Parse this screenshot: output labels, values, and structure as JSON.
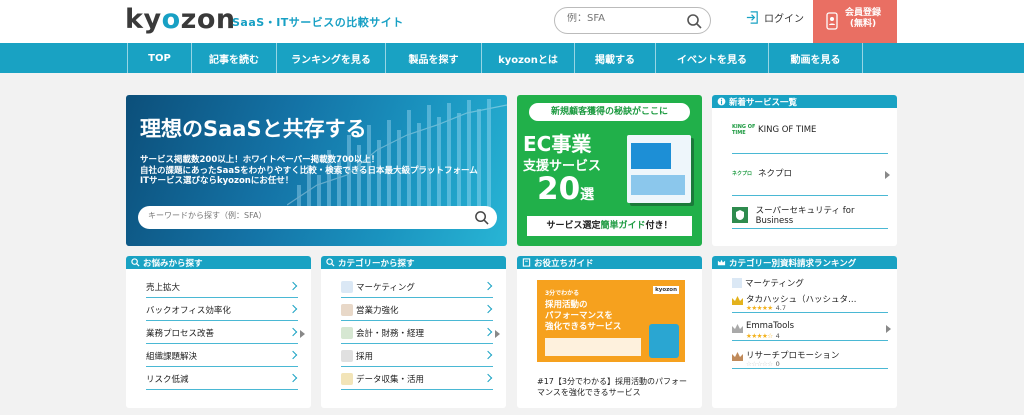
{
  "header": {
    "logo_text": "kyozon",
    "tagline": "SaaS・ITサービスの比較サイト",
    "search_placeholder": "例：SFA",
    "login_label": "ログイン",
    "register_label_line1": "会員登録",
    "register_label_line2": "(無料)"
  },
  "nav": {
    "items": [
      {
        "label": "TOP"
      },
      {
        "label": "記事を読む"
      },
      {
        "label": "ランキングを見る"
      },
      {
        "label": "製品を探す"
      },
      {
        "label": "kyozonとは"
      },
      {
        "label": "掲載する"
      },
      {
        "label": "イベントを見る"
      },
      {
        "label": "動画を見る"
      }
    ]
  },
  "hero": {
    "title": "理想のSaaSと共存する",
    "line1": "サービス掲載数200以上！ホワイトペーパー掲載数700以上！",
    "line2": "自社の課題にあったSaaSをわかりやすく比較・検索できる日本最大級プラットフォーム",
    "line3": "ITサービス選びならkyozonにお任せ！",
    "search_placeholder": "キーワードから探す（例：SFA）"
  },
  "ec_banner": {
    "pill": "新規顧客獲得の秘訣がここに",
    "big": "EC事業",
    "mid": "支援サービス",
    "num": "20",
    "num_suffix": "選",
    "bottom_prefix": "サービス選定",
    "bottom_highlight": "簡単ガイド",
    "bottom_suffix": "付き！"
  },
  "new_services": {
    "title": "新着サービス一覧",
    "items": [
      {
        "logo": "KING OF TIME",
        "name": "KING OF TIME"
      },
      {
        "logo": "ネクプロ",
        "name": "ネクプロ"
      },
      {
        "logo": "",
        "name": "スーパーセキュリティ for Business"
      }
    ]
  },
  "worries": {
    "title": "お悩みから探す",
    "items": [
      {
        "label": "売上拡大"
      },
      {
        "label": "バックオフィス効率化"
      },
      {
        "label": "業務プロセス改善"
      },
      {
        "label": "組織課題解決"
      },
      {
        "label": "リスク低減"
      }
    ]
  },
  "categories": {
    "title": "カテゴリーから探す",
    "items": [
      {
        "label": "マーケティング"
      },
      {
        "label": "営業力強化"
      },
      {
        "label": "会計・財務・経理"
      },
      {
        "label": "採用"
      },
      {
        "label": "データ収集・活用"
      }
    ]
  },
  "guide": {
    "title": "お役立ちガイド",
    "img_tag": "3分でわかる",
    "img_title_1": "採用活動の",
    "img_title_2": "パフォーマンスを",
    "img_title_3": "強化できるサービス",
    "img_brand": "kyozon",
    "caption": "#17【3分でわかる】採用活動のパフォーマンスを強化できるサービス"
  },
  "ranking": {
    "title": "カテゴリー別資料請求ランキング",
    "category": "マーケティング",
    "items": [
      {
        "name": "タカハッシュ（ハッシュタ…",
        "stars": "★★★★★",
        "score": "4.7"
      },
      {
        "name": "EmmaTools",
        "stars": "★★★★☆",
        "score": "4"
      },
      {
        "name": "リサーチプロモーション",
        "stars": "☆☆☆☆☆",
        "score": "0"
      }
    ]
  },
  "colors": {
    "brand": "#19a2c3",
    "register": "#e96f63",
    "ec_green": "#21b04a",
    "guide_orange": "#f6a11e"
  }
}
